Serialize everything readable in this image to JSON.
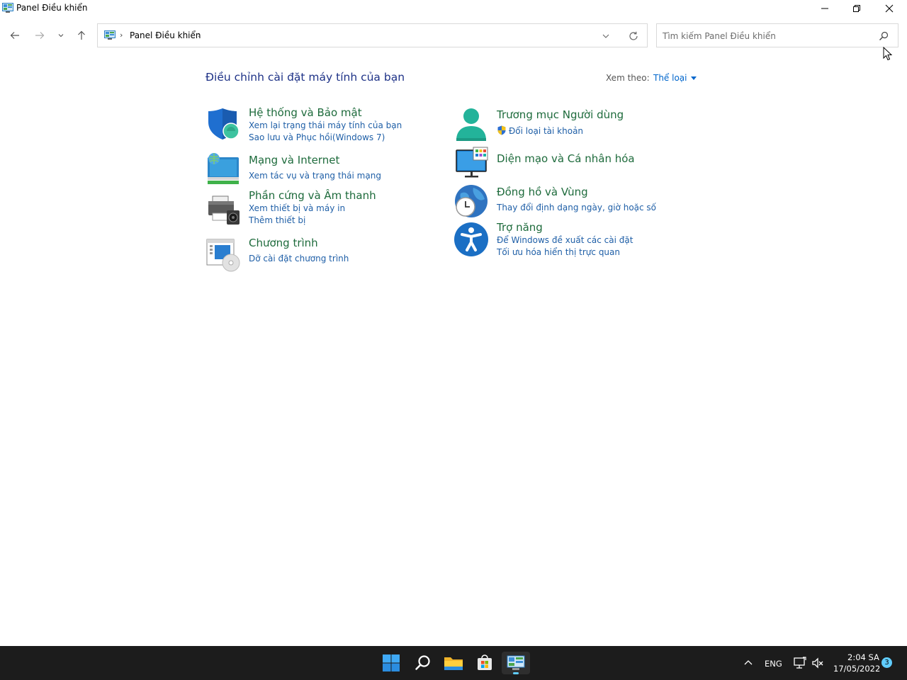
{
  "window": {
    "title": "Panel Điều khiển",
    "minimize_icon": "minimize-icon",
    "maximize_icon": "restore-icon",
    "close_icon": "close-icon"
  },
  "nav": {
    "back_icon": "arrow-left-icon",
    "forward_icon": "arrow-right-icon",
    "recent_icon": "chevron-down-icon",
    "up_icon": "arrow-up-icon"
  },
  "address": {
    "sep": "›",
    "crumb": "Panel Điều khiển",
    "sep2": "›"
  },
  "search": {
    "placeholder": "Tìm kiếm Panel Điều khiển",
    "value": ""
  },
  "main": {
    "heading": "Điều chỉnh cài đặt máy tính của bạn",
    "view_by_label": "Xem theo:",
    "view_by_value": "Thể loại"
  },
  "categories": [
    {
      "title": "Hệ thống và Bảo mật",
      "links": [
        "Xem lại trạng thái máy tính của bạn",
        "Sao lưu và Phục hồi(Windows 7)"
      ],
      "icon": "system-security-icon"
    },
    {
      "title": "Mạng và Internet",
      "links": [
        "Xem tác vụ và trạng thái mạng"
      ],
      "icon": "network-internet-icon"
    },
    {
      "title": "Phần cứng và Âm thanh",
      "links": [
        "Xem thiết bị và máy in",
        "Thêm thiết bị"
      ],
      "icon": "hardware-sound-icon"
    },
    {
      "title": "Chương trình",
      "links": [
        "Dỡ cài đặt chương trình"
      ],
      "icon": "programs-icon"
    },
    {
      "title": "Trương mục Người dùng",
      "links": [
        "Đổi loại tài khoản"
      ],
      "icon": "user-accounts-icon"
    },
    {
      "title": "Diện mạo và Cá nhân hóa",
      "links": [],
      "icon": "appearance-icon"
    },
    {
      "title": "Đồng hồ và Vùng",
      "links": [
        "Thay đổi định dạng ngày, giờ hoặc số"
      ],
      "icon": "clock-region-icon"
    },
    {
      "title": "Trợ năng",
      "links": [
        "Để Windows đề xuất các cài đặt",
        "Tối ưu hóa hiển thị trực quan"
      ],
      "icon": "accessibility-icon"
    }
  ],
  "taskbar": {
    "apps": [
      "start-icon",
      "search-icon",
      "file-explorer-icon",
      "store-icon",
      "control-panel-icon"
    ],
    "language": "ENG",
    "time": "2:04 SA",
    "date": "17/05/2022",
    "notification_count": "3"
  },
  "colors": {
    "heading": "#1e3287",
    "category_title": "#1e6b3c",
    "link": "#1f5fa7",
    "taskbar": "#1c1c1c",
    "accent": "#60cdff"
  }
}
